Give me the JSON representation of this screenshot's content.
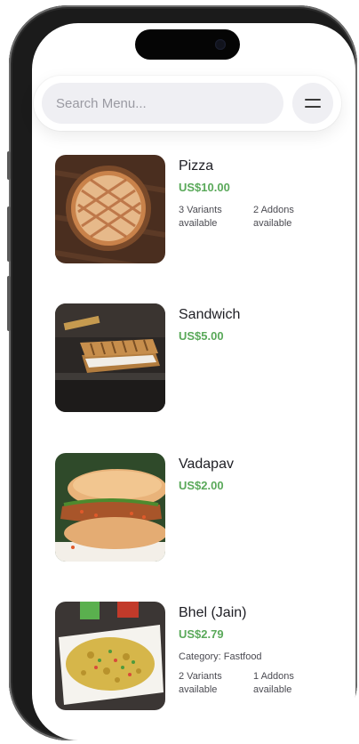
{
  "search": {
    "placeholder": "Search Menu..."
  },
  "menu_icon": "hamburger-icon",
  "colors": {
    "price": "#5aa95a",
    "search_bg": "#efeff3"
  },
  "items": [
    {
      "name": "Pizza",
      "price": "US$10.00",
      "variants": "3 Variants available",
      "addons": "2 Addons available"
    },
    {
      "name": "Sandwich",
      "price": "US$5.00"
    },
    {
      "name": "Vadapav",
      "price": "US$2.00"
    },
    {
      "name": "Bhel (Jain)",
      "price": "US$2.79",
      "category": "Category: Fastfood",
      "variants": "2 Variants available",
      "addons": "1 Addons available"
    }
  ]
}
